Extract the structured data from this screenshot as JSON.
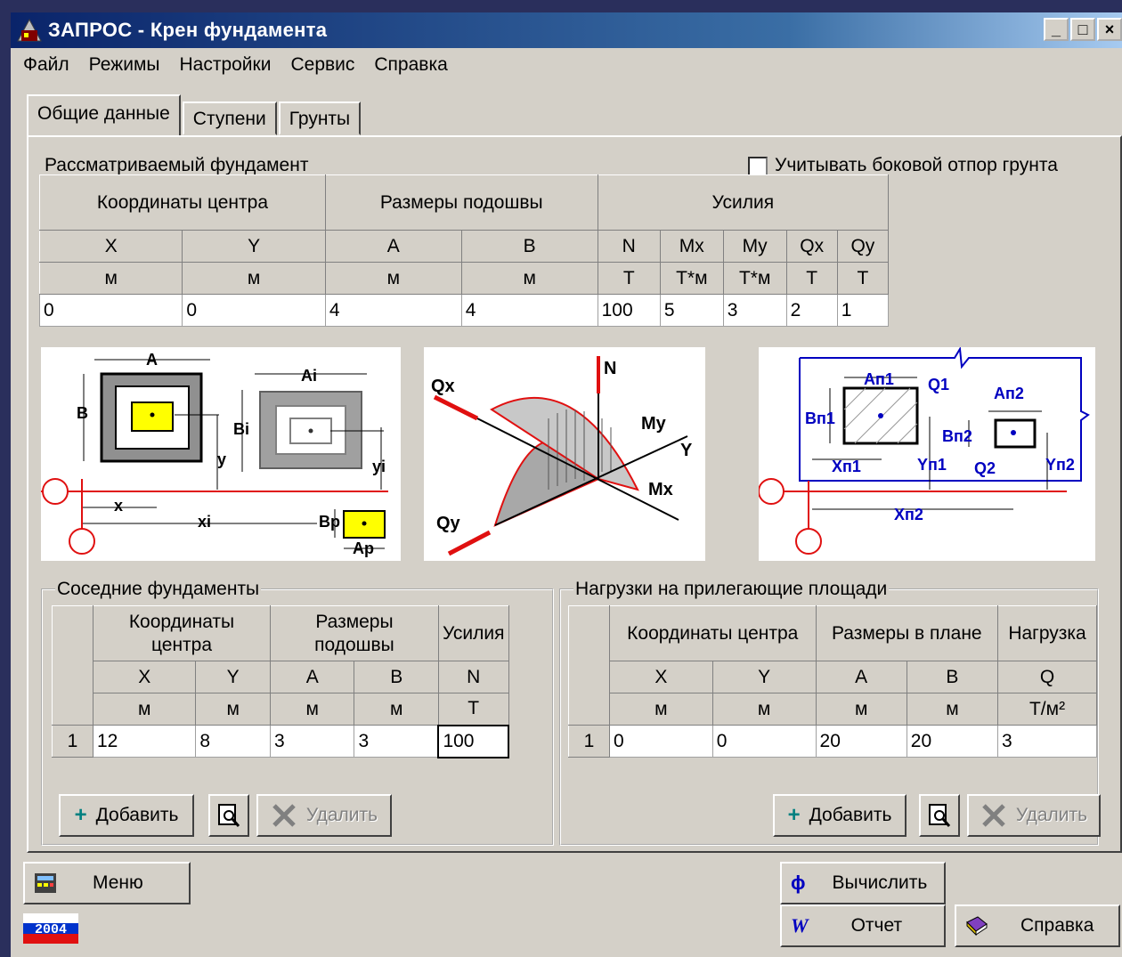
{
  "window": {
    "title": "ЗАПРОС - Крен фундамента",
    "min": "_",
    "max": "□",
    "close": "×"
  },
  "menu": [
    "Файл",
    "Режимы",
    "Настройки",
    "Сервис",
    "Справка"
  ],
  "tabs": [
    "Общие данные",
    "Ступени",
    "Грунты"
  ],
  "main": {
    "section_title": "Рассматриваемый фундамент",
    "checkbox_label": "Учитывать боковой отпор грунта",
    "groups": [
      "Координаты центра",
      "Размеры подошвы",
      "Усилия"
    ],
    "cols": [
      "X",
      "Y",
      "A",
      "B",
      "N",
      "Mx",
      "My",
      "Qx",
      "Qy"
    ],
    "units": [
      "м",
      "м",
      "м",
      "м",
      "Т",
      "Т*м",
      "Т*м",
      "Т",
      "Т"
    ],
    "values": [
      "0",
      "0",
      "4",
      "4",
      "100",
      "5",
      "3",
      "2",
      "1"
    ]
  },
  "diagram1": {
    "labels": [
      "A",
      "Ai",
      "B",
      "Bi",
      "y",
      "yi",
      "x",
      "xi",
      "Bp",
      "Ap"
    ]
  },
  "diagram2": {
    "labels": [
      "N",
      "Qx",
      "My",
      "Y",
      "Mx",
      "Qy"
    ]
  },
  "diagram3": {
    "labels": [
      "Aп1",
      "Q1",
      "Aп2",
      "Bп1",
      "Bп2",
      "Xп1",
      "Yп1",
      "Q2",
      "Yп2",
      "Xп2"
    ]
  },
  "neighbors": {
    "legend": "Соседние фундаменты",
    "groups": [
      "Координаты центра",
      "Размеры подошвы",
      "Усилия"
    ],
    "cols": [
      "X",
      "Y",
      "A",
      "B",
      "N"
    ],
    "units": [
      "м",
      "м",
      "м",
      "м",
      "Т"
    ],
    "rows": [
      {
        "n": "1",
        "values": [
          "12",
          "8",
          "3",
          "3",
          "100"
        ]
      }
    ],
    "add": "Добавить",
    "delete": "Удалить"
  },
  "loads": {
    "legend": "Нагрузки на прилегающие площади",
    "groups": [
      "Координаты центра",
      "Размеры в плане",
      "Нагрузка"
    ],
    "cols": [
      "X",
      "Y",
      "A",
      "B",
      "Q"
    ],
    "units": [
      "м",
      "м",
      "м",
      "м",
      "Т/м²"
    ],
    "rows": [
      {
        "n": "1",
        "values": [
          "0",
          "0",
          "20",
          "20",
          "3"
        ]
      }
    ],
    "add": "Добавить",
    "delete": "Удалить"
  },
  "footer": {
    "menu": "Меню",
    "calc": "Вычислить",
    "report": "Отчет",
    "help": "Справка",
    "year": "2004"
  },
  "colors": {
    "title_start": "#0a246a",
    "title_end": "#a6caf0",
    "face": "#d4d0c8",
    "accent_red": "#e01010",
    "accent_blue": "#0000c0",
    "yellow": "#ffff00"
  }
}
